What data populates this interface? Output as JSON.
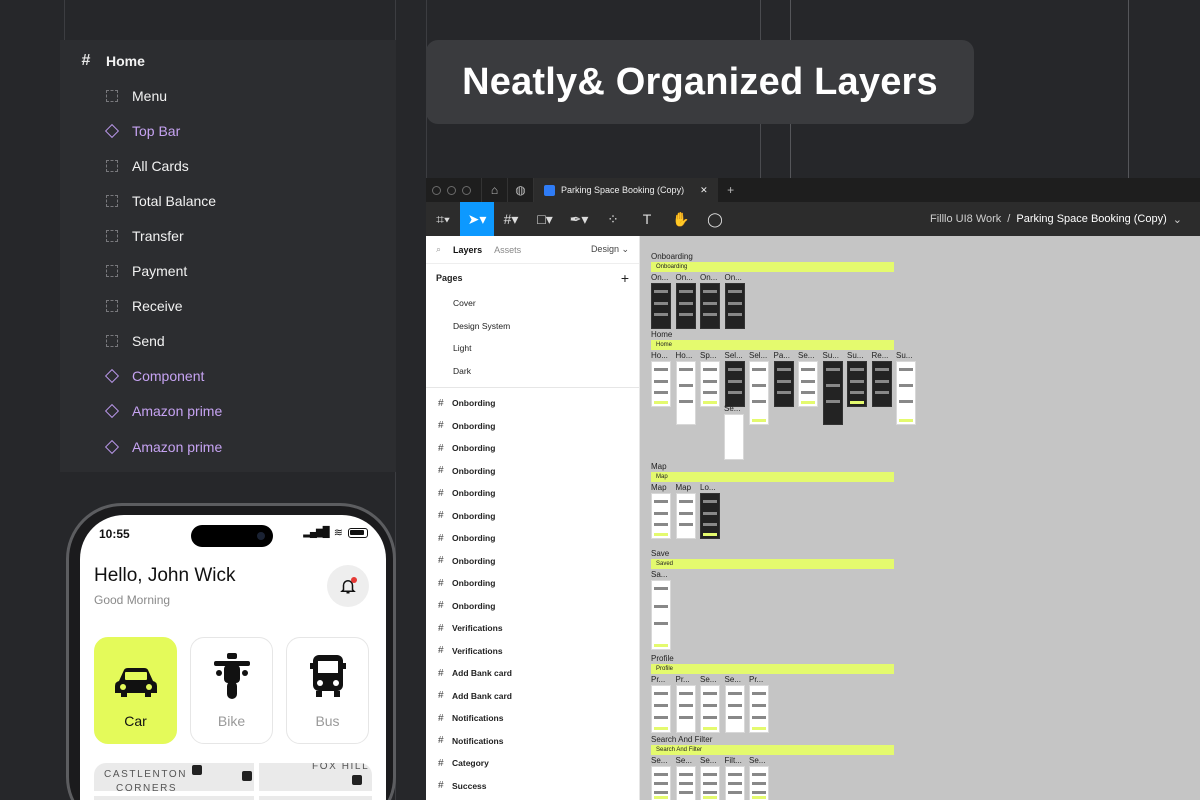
{
  "layers_panel": {
    "home": "Home",
    "items": [
      {
        "label": "Menu",
        "kind": "frame"
      },
      {
        "label": "Top Bar",
        "kind": "component"
      },
      {
        "label": "All Cards",
        "kind": "frame"
      },
      {
        "label": "Total Balance",
        "kind": "frame"
      },
      {
        "label": "Transfer",
        "kind": "frame"
      },
      {
        "label": "Payment",
        "kind": "frame"
      },
      {
        "label": "Receive",
        "kind": "frame"
      },
      {
        "label": "Send",
        "kind": "frame"
      },
      {
        "label": "Component",
        "kind": "component"
      },
      {
        "label": "Amazon prime",
        "kind": "component"
      },
      {
        "label": "Amazon prime",
        "kind": "component"
      }
    ]
  },
  "title": "Neatly& Organized Layers",
  "figma": {
    "tab_title": "Parking Space Booking (Copy)",
    "breadcrumb": {
      "team": "Filllo UI8 Work",
      "separator": "/",
      "file": "Parking Space Booking (Copy)"
    },
    "panel_tabs": {
      "layers": "Layers",
      "assets": "Assets",
      "design": "Design"
    },
    "pages_title": "Pages",
    "pages": [
      "Cover",
      "Design System",
      "Light",
      "Dark"
    ],
    "frames": [
      "Onbording",
      "Onbording",
      "Onbording",
      "Onbording",
      "Onbording",
      "Onbording",
      "Onbording",
      "Onbording",
      "Onbording",
      "Onbording",
      "Verifications",
      "Verifications",
      "Add Bank card",
      "Add Bank card",
      "Notifications",
      "Notifications",
      "Category",
      "Success"
    ],
    "canvas": {
      "sections": [
        {
          "label": "Onboarding",
          "bar": "Onboarding",
          "thumbs": [
            "On...",
            "On...",
            "On...",
            "On..."
          ]
        },
        {
          "label": "Home",
          "bar": "Home",
          "thumbs": [
            "Ho...",
            "Ho...",
            "Sp...",
            "Sel...",
            "Sel...",
            "Pa...",
            "Se...",
            "Su...",
            "Su...",
            "Re...",
            "Su..."
          ]
        },
        {
          "label": "Map",
          "bar": "Map",
          "thumbs": [
            "Map",
            "Map",
            "Lo..."
          ]
        },
        {
          "label": "Save",
          "bar": "Saved",
          "thumbs": [
            "Sa..."
          ]
        },
        {
          "label": "Profile",
          "bar": "Profile",
          "thumbs": [
            "Pr...",
            "Pr...",
            "Se...",
            "Se...",
            "Pr..."
          ]
        },
        {
          "label": "Search And Filter",
          "bar": "Search And Filter",
          "thumbs": [
            "Se...",
            "Se...",
            "Se...",
            "Filt...",
            "Se..."
          ]
        }
      ],
      "extra_thumb": "Se..."
    }
  },
  "phone": {
    "time": "10:55",
    "greeting": "Hello, John Wick",
    "subtitle": "Good Morning",
    "vehicles": [
      {
        "label": "Car",
        "selected": true
      },
      {
        "label": "Bike",
        "selected": false
      },
      {
        "label": "Bus",
        "selected": false
      }
    ],
    "map_labels": [
      "CASTLENTON",
      "CORNERS",
      "FOX HILL"
    ]
  },
  "colors": {
    "accent_lime": "#e4fa5a",
    "component_purple": "#c6a3f2",
    "figma_blue": "#0d99ff"
  }
}
